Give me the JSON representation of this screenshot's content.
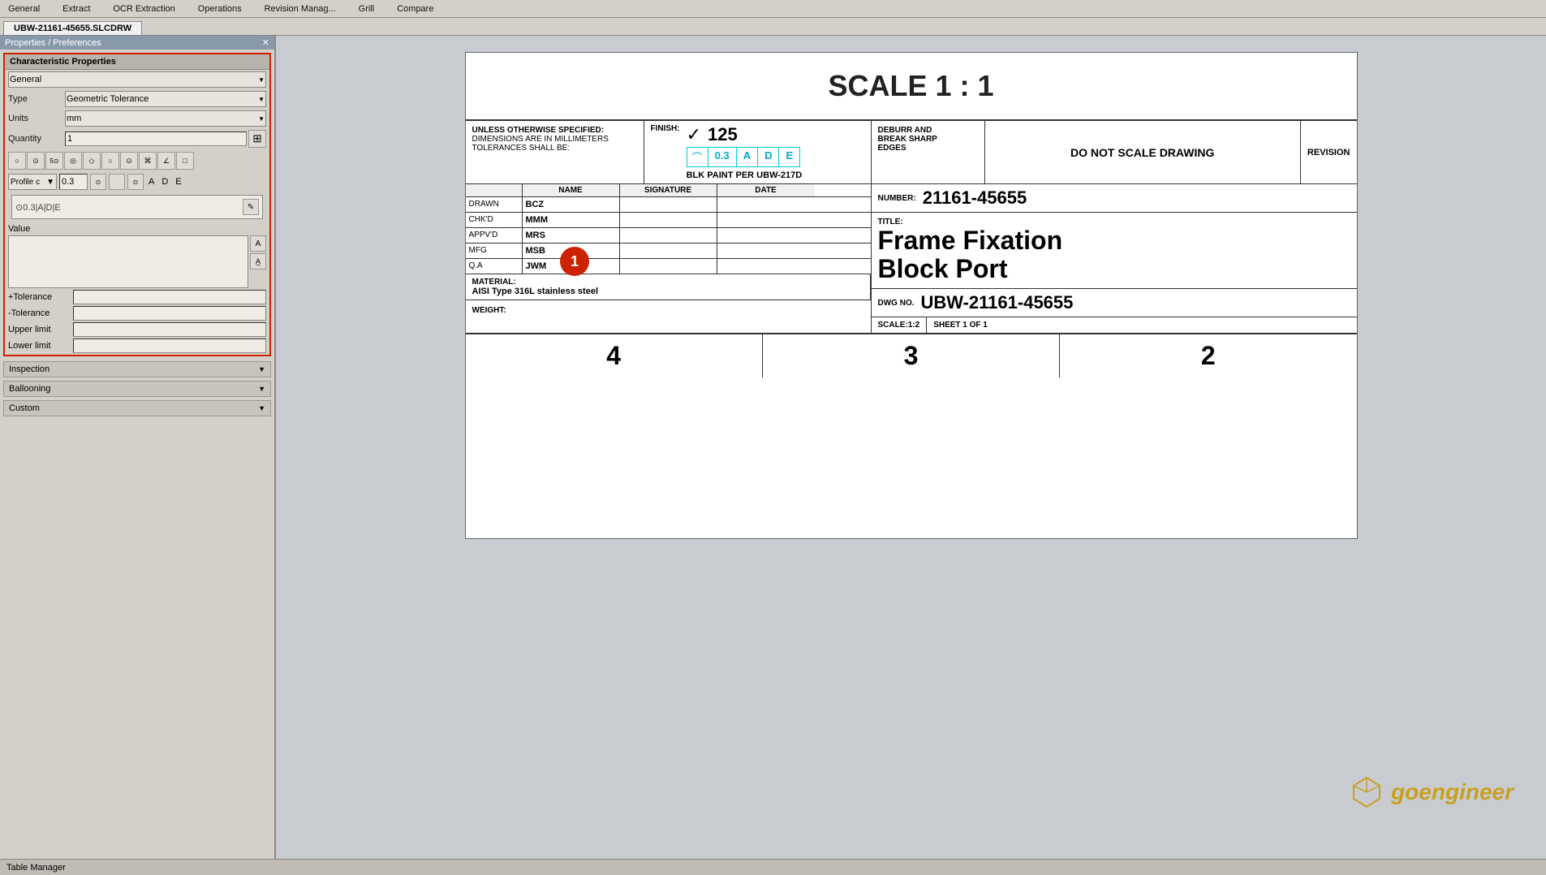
{
  "toolbar": {
    "items": [
      "General",
      "Extract",
      "OCR Extraction",
      "Operations",
      "Revision Manag...",
      "Grill",
      "Compare"
    ]
  },
  "tab": {
    "filename": "UBW-21161-45655.SLCDRW"
  },
  "sidebar": {
    "title": "Properties / Preferences",
    "panel_title": "Characteristic Properties",
    "general_label": "General",
    "type_label": "Type",
    "type_value": "Geometric Tolerance",
    "units_label": "Units",
    "units_value": "mm",
    "quantity_label": "Quantity",
    "quantity_value": "1",
    "profile_label": "Profile c",
    "profile_value": "0.3",
    "profile_letters": [
      "A",
      "D",
      "E"
    ],
    "value_label": "Value",
    "fcf_display": "⊙0.3|A|D|E",
    "plus_tol_label": "+Tolerance",
    "minus_tol_label": "-Tolerance",
    "upper_limit_label": "Upper limit",
    "lower_limit_label": "Lower limit",
    "inspection_label": "Inspection",
    "ballooning_label": "Ballooning",
    "custom_label": "Custom"
  },
  "drawing": {
    "scale_title": "SCALE 1 : 1",
    "notes_title": "UNLESS OTHERWISE SPECIFIED:",
    "notes_line1": "DIMENSIONS ARE IN MILLIMETERS",
    "notes_line2": "TOLERANCES SHALL BE:",
    "finish_label": "FINISH:",
    "finish_number": "125",
    "finish_paint": "BLK PAINT PER UBW-217D",
    "fcf_symbol": "⌒",
    "fcf_value": "0.3",
    "fcf_datum1": "A",
    "fcf_datum2": "D",
    "fcf_datum3": "E",
    "deburr_label": "DEBURR AND\nBREAK SHARP\nEDGES",
    "do_not_scale": "DO NOT SCALE DRAWING",
    "revision_label": "REVISION",
    "number_label": "NUMBER:",
    "number_value": "21161-45655",
    "title_label": "TITLE:",
    "title_line1": "Frame Fixation",
    "title_line2": "Block Port",
    "dwgno_label": "DWG NO.",
    "dwgno_value": "UBW-21161-45655",
    "scale_label": "SCALE:1:2",
    "sheet_label": "SHEET 1 OF 1",
    "material_label": "MATERIAL:",
    "material_value": "AISI Type 316L stainless steel",
    "weight_label": "WEIGHT:",
    "sig_headers": [
      "",
      "NAME",
      "SIGNATURE",
      "DATE"
    ],
    "signatures": [
      {
        "role": "DRAWN",
        "name": "BCZ",
        "sig": "",
        "date": ""
      },
      {
        "role": "CHK'D",
        "name": "MMM",
        "sig": "",
        "date": ""
      },
      {
        "role": "APPV'D",
        "name": "MRS",
        "sig": "",
        "date": ""
      },
      {
        "role": "MFG",
        "name": "MSB",
        "sig": "",
        "date": ""
      },
      {
        "role": "Q.A",
        "name": "JWM",
        "sig": "",
        "date": ""
      }
    ],
    "bottom_numbers": [
      "4",
      "3",
      "2"
    ]
  },
  "status_bar": {
    "label": "Table Manager"
  },
  "icons": {
    "circle": "○",
    "circle_dot": "⊙",
    "circle_half": "◑",
    "target": "◎",
    "cylinder": "⌭",
    "diamond": "◇",
    "square": "□",
    "wavy": "〜",
    "arc": "⌒",
    "edit": "✎",
    "text_format": "A",
    "text_style": "A̲"
  }
}
